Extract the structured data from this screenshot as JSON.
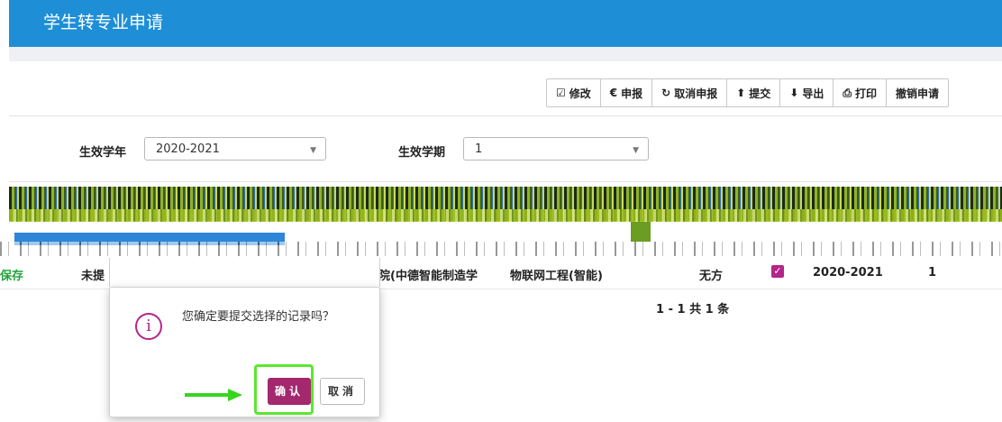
{
  "page": {
    "title": "学生转专业申请"
  },
  "toolbar": {
    "buttons": [
      {
        "icon": "edit-icon",
        "glyph": "☑",
        "label": "修改"
      },
      {
        "icon": "euro-icon",
        "glyph": "€",
        "label": "申报"
      },
      {
        "icon": "refresh-icon",
        "glyph": "↻",
        "label": "取消申报"
      },
      {
        "icon": "upload-icon",
        "glyph": "⬆",
        "label": "提交"
      },
      {
        "icon": "export-icon",
        "glyph": "⬇",
        "label": "导出"
      },
      {
        "icon": "print-icon",
        "glyph": "⎙",
        "label": "打印"
      },
      {
        "icon": "",
        "glyph": "",
        "label": "撤销申请"
      }
    ]
  },
  "filters": {
    "year_label": "生效学年",
    "year_value": "2020-2021",
    "term_label": "生效学期",
    "term_value": "1"
  },
  "table": {
    "row": {
      "action": "保存",
      "status": "未提",
      "college": "院(中德智能制造学",
      "major": "物联网工程(智能)",
      "direction": "无方",
      "year": "2020-2021",
      "term": "1"
    },
    "pager": "1 - 1   共 1 条"
  },
  "dialog": {
    "message": "您确定要提交选择的记录吗？",
    "confirm_label": "确认",
    "cancel_label": "取消"
  },
  "colors": {
    "header_blue": "#1e8fd6",
    "accent_magenta": "#a3286e",
    "highlight_green": "#5ce62e"
  }
}
